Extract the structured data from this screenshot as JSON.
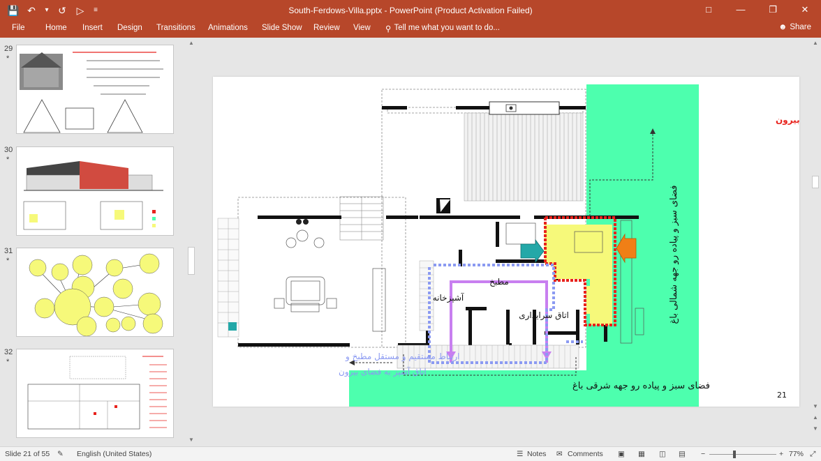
{
  "window": {
    "title": "South-Ferdows-Villa.pptx - PowerPoint (Product Activation Failed)",
    "accent": "#b7472a"
  },
  "qat": {
    "icons": [
      "save-icon",
      "undo-icon",
      "redo-icon",
      "present-icon",
      "customize-icon"
    ]
  },
  "ribbon": {
    "tabs": [
      "File",
      "Home",
      "Insert",
      "Design",
      "Transitions",
      "Animations",
      "Slide Show",
      "Review",
      "View"
    ],
    "tell_me": "Tell me what you want to do...",
    "share": "Share"
  },
  "thumbnails": [
    {
      "number": "29",
      "star": "*"
    },
    {
      "number": "30",
      "star": "*"
    },
    {
      "number": "31",
      "star": "*"
    },
    {
      "number": "32",
      "star": "*"
    }
  ],
  "slide": {
    "number": "21",
    "label_guest": "ارتباط مستقل اتاق مهمان با فضای بیرون",
    "label_north": "فضای سبز و پیاده رو جهه شمالی باغ",
    "label_kitchen_link_1": "ارتباط مستقیم و مستقل مطبخ و",
    "label_kitchen_link_2": "اتاق آشپز به فضای بیرون",
    "label_east": "فضای سبز و پیاده رو جهه شرقی باغ",
    "room_matbakh": "مطبخ",
    "room_ashpazkhaneh": "آشپزخانه",
    "room_saraydari": "اتاق سرایداری",
    "colors": {
      "green": "#4dffae",
      "yellow": "#f6f97a",
      "red": "#e8221c",
      "purple": "#c87ff0",
      "blue": "#8b9af2",
      "teal": "#23a8a8",
      "orange": "#f07f16"
    }
  },
  "status": {
    "slide_info": "Slide 21 of 55",
    "language": "English (United States)",
    "notes": "Notes",
    "comments": "Comments",
    "zoom": "77%"
  }
}
